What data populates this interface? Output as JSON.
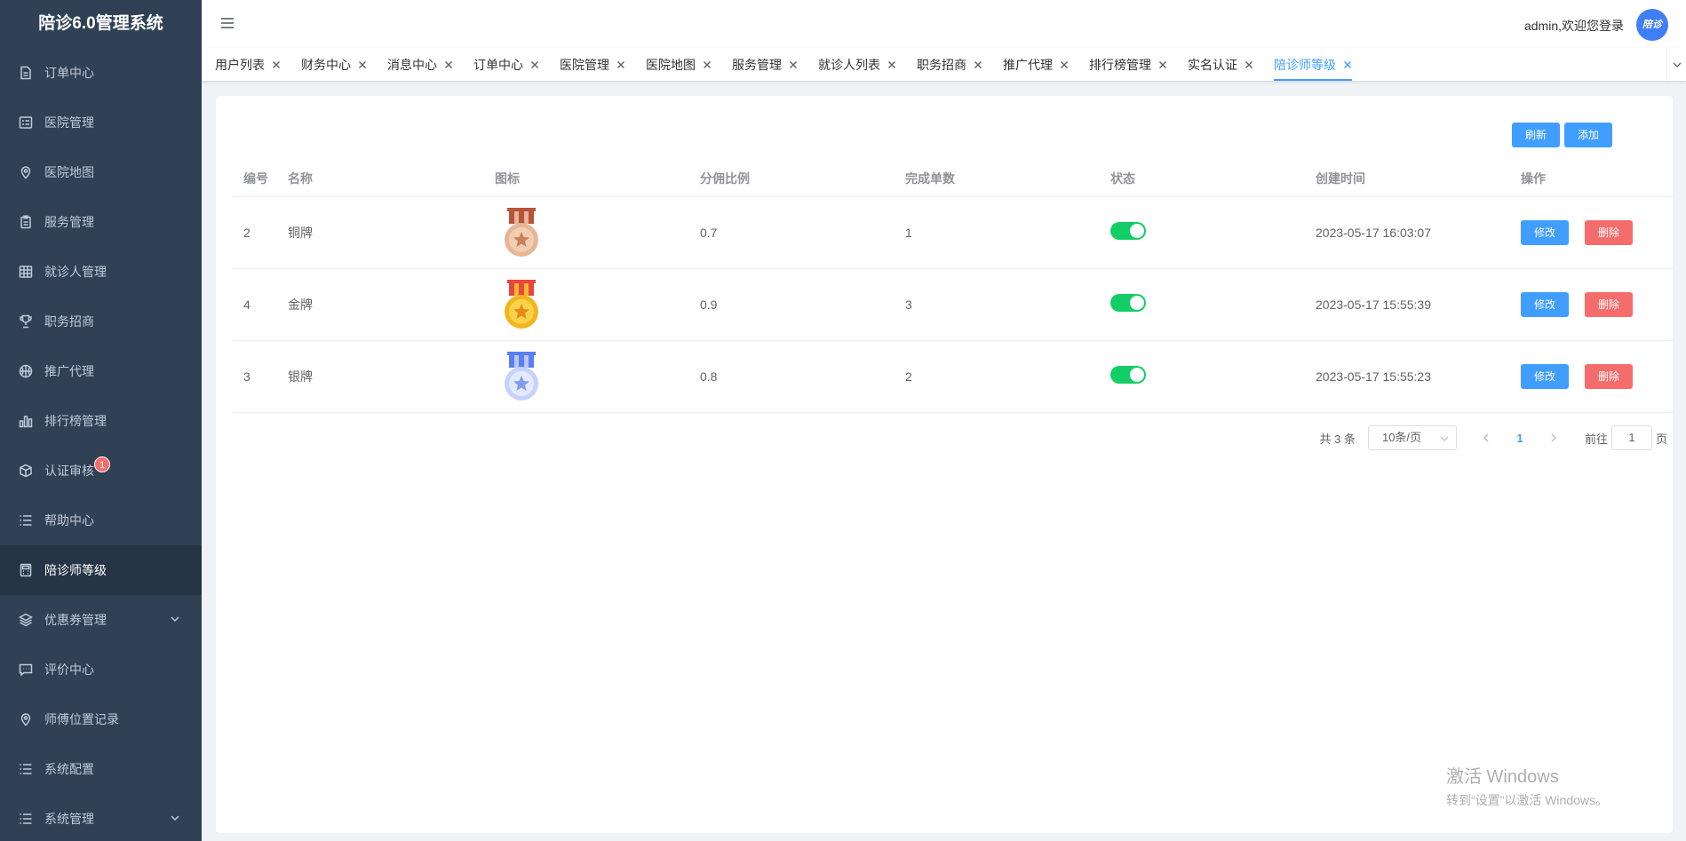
{
  "app": {
    "title": "陪诊6.0管理系统"
  },
  "sidebar": {
    "items": [
      {
        "label": "订单中心",
        "icon": "document-icon"
      },
      {
        "label": "医院管理",
        "icon": "list-icon"
      },
      {
        "label": "医院地图",
        "icon": "location-icon"
      },
      {
        "label": "服务管理",
        "icon": "clipboard-icon"
      },
      {
        "label": "就诊人管理",
        "icon": "grid-icon"
      },
      {
        "label": "职务招商",
        "icon": "trophy-icon"
      },
      {
        "label": "推广代理",
        "icon": "basketball-icon"
      },
      {
        "label": "排行榜管理",
        "icon": "bar-chart-icon"
      },
      {
        "label": "认证审核",
        "icon": "box-icon",
        "badge": "1"
      },
      {
        "label": "帮助中心",
        "icon": "menu-icon"
      },
      {
        "label": "陪诊师等级",
        "icon": "calculator-icon",
        "active": true
      },
      {
        "label": "优惠券管理",
        "icon": "layers-icon",
        "expandable": true
      },
      {
        "label": "评价中心",
        "icon": "chat-icon"
      },
      {
        "label": "师傅位置记录",
        "icon": "location-icon"
      },
      {
        "label": "系统配置",
        "icon": "menu-icon"
      },
      {
        "label": "系统管理",
        "icon": "menu-icon",
        "expandable": true
      }
    ]
  },
  "header": {
    "welcome": "admin,欢迎您登录",
    "avatar_text": "陪诊"
  },
  "tags": [
    {
      "label": "用户列表"
    },
    {
      "label": "财务中心"
    },
    {
      "label": "消息中心"
    },
    {
      "label": "订单中心"
    },
    {
      "label": "医院管理"
    },
    {
      "label": "医院地图"
    },
    {
      "label": "服务管理"
    },
    {
      "label": "就诊人列表"
    },
    {
      "label": "职务招商"
    },
    {
      "label": "推广代理"
    },
    {
      "label": "排行榜管理"
    },
    {
      "label": "实名认证"
    },
    {
      "label": "陪诊师等级",
      "active": true
    }
  ],
  "toolbar": {
    "refresh_label": "刷新",
    "add_label": "添加"
  },
  "table": {
    "columns": [
      "编号",
      "名称",
      "图标",
      "分佣比例",
      "完成单数",
      "状态",
      "创建时间",
      "操作"
    ],
    "rows": [
      {
        "id": "2",
        "name": "铜牌",
        "medal": "bronze-medal-icon",
        "ratio": "0.7",
        "count": "1",
        "status": true,
        "created": "2023-05-17 16:03:07"
      },
      {
        "id": "4",
        "name": "金牌",
        "medal": "gold-medal-icon",
        "ratio": "0.9",
        "count": "3",
        "status": true,
        "created": "2023-05-17 15:55:39"
      },
      {
        "id": "3",
        "name": "银牌",
        "medal": "silver-medal-icon",
        "ratio": "0.8",
        "count": "2",
        "status": true,
        "created": "2023-05-17 15:55:23"
      }
    ],
    "edit_label": "修改",
    "delete_label": "删除"
  },
  "pagination": {
    "total": "共 3 条",
    "page_size": "10条/页",
    "current_page": "1",
    "goto_label": "前往",
    "goto_value": "1",
    "page_suffix": "页"
  },
  "watermark": {
    "line1": "激活 Windows",
    "line2": "转到“设置”以激活 Windows。"
  },
  "colors": {
    "sidebar_bg": "#304156",
    "primary": "#409eff",
    "danger": "#f56c6c",
    "switch_on": "#13ce66",
    "bronze": "#c8805a",
    "gold": "#f3b51c",
    "silver": "#7f9cf0"
  }
}
